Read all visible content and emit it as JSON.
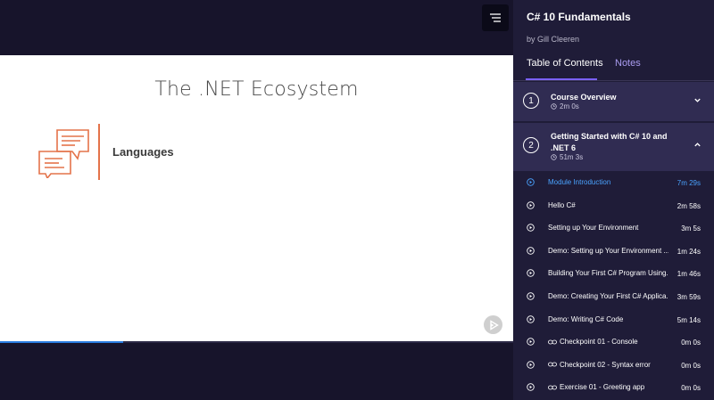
{
  "course": {
    "title": "C# 10 Fundamentals",
    "author": "by Gill Cleeren"
  },
  "tabs": {
    "toc": "Table of Contents",
    "notes": "Notes"
  },
  "slide": {
    "title": "The .NET Ecosystem",
    "label": "Languages",
    "accent": "#e4734a"
  },
  "progress": {
    "fraction": 0.24
  },
  "modules": [
    {
      "number": "1",
      "title": "Course Overview",
      "duration": "2m 0s",
      "expanded": false
    },
    {
      "number": "2",
      "title": "Getting Started with C# 10 and .NET 6",
      "duration": "51m 3s",
      "expanded": true
    }
  ],
  "clips": [
    {
      "title": "Module Introduction",
      "duration": "7m 29s",
      "active": true,
      "link": false
    },
    {
      "title": "Hello C#",
      "duration": "2m 58s",
      "active": false,
      "link": false
    },
    {
      "title": "Setting up Your Environment",
      "duration": "3m 5s",
      "active": false,
      "link": false
    },
    {
      "title": "Demo: Setting up Your Environment ...",
      "duration": "1m 24s",
      "active": false,
      "link": false
    },
    {
      "title": "Building Your First C# Program Using...",
      "duration": "1m 46s",
      "active": false,
      "link": false
    },
    {
      "title": "Demo: Creating Your First C# Applica...",
      "duration": "3m 59s",
      "active": false,
      "link": false
    },
    {
      "title": "Demo: Writing C# Code",
      "duration": "5m 14s",
      "active": false,
      "link": false
    },
    {
      "title": "Checkpoint 01 - Console",
      "duration": "0m 0s",
      "active": false,
      "link": true
    },
    {
      "title": "Checkpoint 02 - Syntax error",
      "duration": "0m 0s",
      "active": false,
      "link": true
    },
    {
      "title": "Exercise 01 - Greeting app",
      "duration": "0m 0s",
      "active": false,
      "link": true
    }
  ],
  "colors": {
    "background": "#17142b",
    "sidebar": "#1f1c38",
    "module": "#302c52",
    "tab_accent": "#7b61ff",
    "active_clip": "#4aa3ff",
    "progress": "#2a7de1"
  }
}
